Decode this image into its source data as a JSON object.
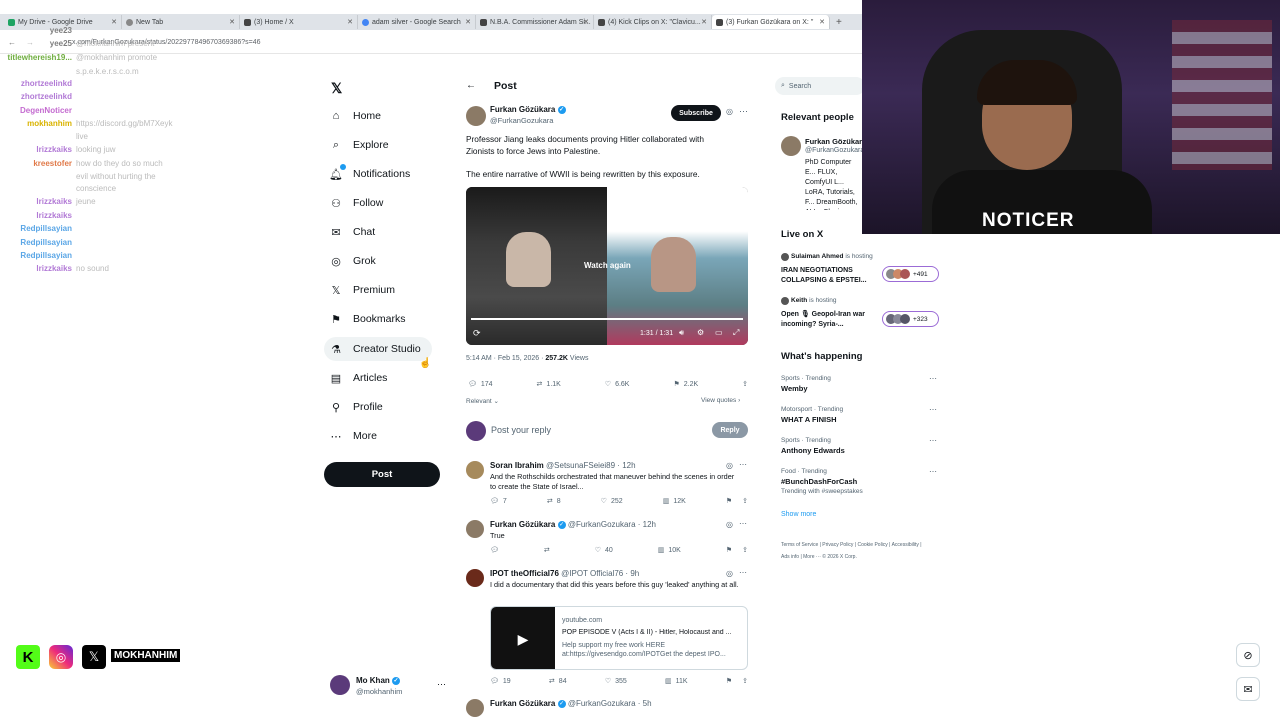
{
  "browser": {
    "tabs": [
      "My Drive - Google Drive",
      "New Tab",
      "(3) Home / X",
      "adam silver - Google Search",
      "N.B.A. Commissioner Adam Si...",
      "(4) Kick Clips on X: \"Clavicu...",
      "(3) Furkan Gözükara on X: \""
    ],
    "url": "x.com/FurkanGozukara/status/2022977849670369386?s=46"
  },
  "chat_overlay": {
    "messages": [
      {
        "user": "yee23",
        "text": "",
        "color": "#7e7e7e"
      },
      {
        "user": "yee25",
        "text": "@mokhanhim present",
        "color": "#7e7e7e"
      },
      {
        "user": "titlewhereish19...",
        "text": "@mokhanhim promote",
        "color": "#6fae3f"
      },
      {
        "user": "",
        "text": "s.p.e.k.e.r.s.c.o.m",
        "color": "#7e7e7e"
      },
      {
        "user": "zhortzeelinkd",
        "text": "",
        "color": "#b27ad6"
      },
      {
        "user": "zhortzeelinkd",
        "text": "",
        "color": "#b27ad6"
      },
      {
        "user": "DegenNoticer",
        "text": "",
        "color": "#c46bd0"
      },
      {
        "user": "mokhanhim",
        "text": "https://discord.gg/bM7Xeyk",
        "color": "#d9b300"
      },
      {
        "user": "",
        "text": "live",
        "color": "#7e7e7e"
      },
      {
        "user": "lrizzkaiks",
        "text": "looking juw",
        "color": "#b27ad6"
      },
      {
        "user": "kreestofer",
        "text": "how do they do so much",
        "color": "#e07a4a"
      },
      {
        "user": "",
        "text": "evil without hurting the",
        "color": "#7e7e7e"
      },
      {
        "user": "",
        "text": "conscience",
        "color": "#7e7e7e"
      },
      {
        "user": "lrizzkaiks",
        "text": "jeune",
        "color": "#b27ad6"
      },
      {
        "user": "lrizzkaiks",
        "text": "",
        "color": "#b27ad6"
      },
      {
        "user": "Redpillsayian",
        "text": "",
        "color": "#5aa6e6"
      },
      {
        "user": "Redpillsayian",
        "text": "",
        "color": "#5aa6e6"
      },
      {
        "user": "Redpillsayian",
        "text": "",
        "color": "#5aa6e6"
      },
      {
        "user": "lrizzkaiks",
        "text": "no sound",
        "color": "#b27ad6"
      }
    ]
  },
  "nav": {
    "items": [
      "Home",
      "Explore",
      "Notifications",
      "Follow",
      "Chat",
      "Grok",
      "Premium",
      "Bookmarks",
      "Creator Studio",
      "Articles",
      "Profile",
      "More"
    ],
    "post_label": "Post",
    "account": {
      "name": "Mo Khan",
      "handle": "@mokhanhim"
    }
  },
  "post": {
    "header": "Post",
    "author": "Furkan Gözükara",
    "handle": "@FurkanGozukara",
    "subscribe": "Subscribe",
    "text1": "Professor Jiang leaks documents proving Hitler collaborated with Zionists to force Jews into Palestine.",
    "text2": "The entire narrative of WWII is being rewritten by this exposure.",
    "video": {
      "watch_again": "Watch again",
      "time": "1:31 / 1:31"
    },
    "meta_time": "5:14 AM · Feb 15, 2026 ·",
    "views": "257.2K",
    "views_label": "Views",
    "stats": {
      "replies": "174",
      "reposts": "1.1K",
      "likes": "6.6K",
      "bookmarks": "2.2K"
    },
    "relevant": "Relevant",
    "view_quotes": "View quotes",
    "reply_placeholder": "Post your reply",
    "reply_btn": "Reply"
  },
  "replies": [
    {
      "name": "Soran Ibrahim",
      "handle": "@SetsunaFSeiei89 · 12h",
      "text": "And the Rothschilds orchestrated that maneuver behind the scenes in order to create the State of Israel...",
      "stats": [
        "7",
        "8",
        "252",
        "12K"
      ]
    },
    {
      "name": "Furkan Gözükara",
      "handle": "@FurkanGozukara · 12h",
      "text": "True",
      "stats": [
        "",
        "",
        "40",
        "10K"
      ]
    },
    {
      "name": "IPOT theOfficial76",
      "handle": "@IPOT Official76 · 9h",
      "text": "I did a documentary that did this years before this guy 'leaked' anything at all.",
      "stats": [
        "19",
        "84",
        "355",
        "11K"
      ],
      "card": {
        "domain": "youtube.com",
        "title": "POP EPISODE V (Acts I & II) - Hitler, Holocaust and ...",
        "desc": "Help support my free work HERE at:https://givesendgo.com/IPOTGet the depest IPO..."
      }
    },
    {
      "name": "Furkan Gözükara",
      "handle": "@FurkanGozukara · 5h",
      "text": "",
      "stats": []
    }
  ],
  "right": {
    "search_placeholder": "Search",
    "relevant_title": "Relevant people",
    "rel_person": {
      "name": "Furkan Gözükara",
      "handle": "@FurkanGozukara",
      "bio": "PhD Computer E... FLUX, ComfyUI L... LoRA, Tutorials, F... DreamBooth, AI I... Cloning, Tech - P..."
    },
    "live_title": "Live on X",
    "live": [
      {
        "host": "Sulaiman Ahmed",
        "suffix": "is hosting",
        "title": "IRAN NEGOTIATIONS COLLAPSING & EPSTEI...",
        "count": "+491"
      },
      {
        "host": "Keith",
        "suffix": "is hosting",
        "title": "Open 🎙 Geopol-Iran war incoming? Syria-...",
        "count": "+323"
      }
    ],
    "happening_title": "What's happening",
    "trends": [
      {
        "cat": "Sports · Trending",
        "name": "Wemby",
        "sub": ""
      },
      {
        "cat": "Motorsport · Trending",
        "name": "WHAT A FINISH",
        "sub": ""
      },
      {
        "cat": "Sports · Trending",
        "name": "Anthony Edwards",
        "sub": ""
      },
      {
        "cat": "Food · Trending",
        "name": "#BunchDashForCash",
        "sub": "Trending with #sweepstakes"
      }
    ],
    "show_more": "Show more",
    "footer": "Terms of Service | Privacy Policy | Cookie Policy | Accessibility | Ads info | More ··· © 2026 X Corp."
  },
  "overlay": {
    "social_handle": "MOKHANHIM",
    "cam_text": "NOTICER"
  },
  "colors": {
    "x_blue": "#1d9bf0",
    "dark": "#0f1419",
    "muted": "#536471",
    "kick": "#53fc18"
  }
}
